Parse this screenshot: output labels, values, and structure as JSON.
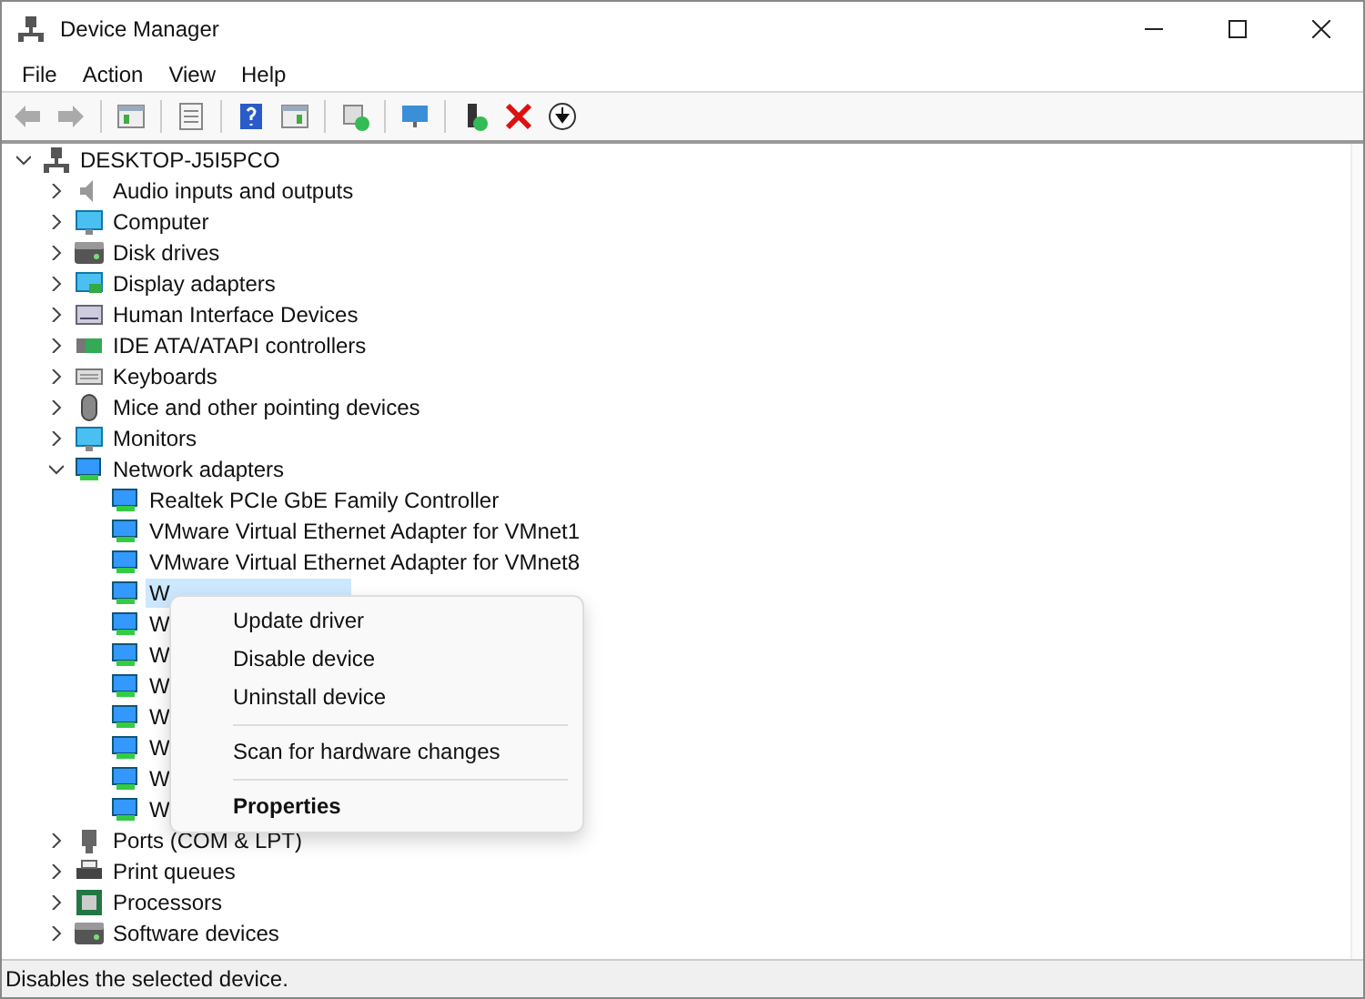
{
  "window": {
    "title": "Device Manager"
  },
  "menu_bar": [
    "File",
    "Action",
    "View",
    "Help"
  ],
  "toolbar": [
    {
      "kind": "back",
      "disabled": true
    },
    {
      "kind": "forward",
      "disabled": true
    },
    {
      "kind": "separator"
    },
    {
      "kind": "tree-view"
    },
    {
      "kind": "separator"
    },
    {
      "kind": "properties"
    },
    {
      "kind": "separator"
    },
    {
      "kind": "help"
    },
    {
      "kind": "pane"
    },
    {
      "kind": "separator"
    },
    {
      "kind": "scan"
    },
    {
      "kind": "separator"
    },
    {
      "kind": "monitor"
    },
    {
      "kind": "separator"
    },
    {
      "kind": "enable"
    },
    {
      "kind": "delete"
    },
    {
      "kind": "download"
    }
  ],
  "tree": {
    "label": "DESKTOP-J5I5PCO",
    "expanded": true,
    "children": [
      {
        "label": "Audio inputs and outputs",
        "kind": "speaker",
        "expanded": false
      },
      {
        "label": "Computer",
        "kind": "monitor",
        "expanded": false
      },
      {
        "label": "Disk drives",
        "kind": "disk",
        "expanded": false
      },
      {
        "label": "Display adapters",
        "kind": "display",
        "expanded": false
      },
      {
        "label": "Human Interface Devices",
        "kind": "hid",
        "expanded": false
      },
      {
        "label": "IDE ATA/ATAPI controllers",
        "kind": "card",
        "expanded": false
      },
      {
        "label": "Keyboards",
        "kind": "keyboard",
        "expanded": false
      },
      {
        "label": "Mice and other pointing devices",
        "kind": "mouse",
        "expanded": false
      },
      {
        "label": "Monitors",
        "kind": "monitor",
        "expanded": false
      },
      {
        "label": "Network adapters",
        "kind": "network",
        "expanded": true,
        "children": [
          {
            "label": "Realtek PCIe GbE Family Controller",
            "selected": false
          },
          {
            "label": "VMware Virtual Ethernet Adapter for VMnet1",
            "selected": false
          },
          {
            "label": "VMware Virtual Ethernet Adapter for VMnet8",
            "selected": false
          },
          {
            "label": "W",
            "selected": true
          },
          {
            "label": "W",
            "selected": false
          },
          {
            "label": "W",
            "selected": false
          },
          {
            "label": "W",
            "selected": false
          },
          {
            "label": "W",
            "selected": false
          },
          {
            "label": "W",
            "selected": false
          },
          {
            "label": "W",
            "selected": false
          },
          {
            "label": "W",
            "selected": false
          }
        ]
      },
      {
        "label": "Ports (COM & LPT)",
        "kind": "port",
        "expanded": false
      },
      {
        "label": "Print queues",
        "kind": "printer",
        "expanded": false
      },
      {
        "label": "Processors",
        "kind": "chip",
        "expanded": false
      },
      {
        "label": "Software devices",
        "kind": "disk",
        "expanded": false
      }
    ]
  },
  "context_menu": [
    [
      {
        "label": "Update driver",
        "default": false
      },
      {
        "label": "Disable device",
        "default": false
      },
      {
        "label": "Uninstall device",
        "default": false
      }
    ],
    [
      {
        "label": "Scan for hardware changes",
        "default": false
      }
    ],
    [
      {
        "label": "Properties",
        "default": true
      }
    ]
  ],
  "status_bar": "Disables the selected device."
}
